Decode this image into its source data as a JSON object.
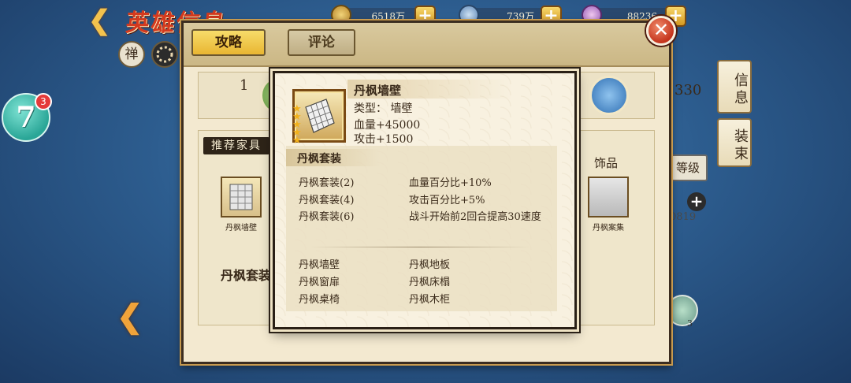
{
  "topbar": {
    "hero_title": "英雄信息",
    "resources": [
      {
        "icon": "coin-icon",
        "value": "6518万"
      },
      {
        "icon": "fish-icon",
        "value": "739万"
      },
      {
        "icon": "gem-icon",
        "value": "88236"
      }
    ]
  },
  "left": {
    "badge_number": "7",
    "badge_count": "3",
    "zen_label": "禅"
  },
  "panel": {
    "tabs": [
      {
        "label": "攻略",
        "active": true
      },
      {
        "label": "评论",
        "active": false
      }
    ],
    "hero_row_number": "1",
    "recommended_label": "推荐家具",
    "furniture_items": [
      "丹枫墙壁",
      ""
    ],
    "suit_name": "丹枫套装",
    "decor_label": "饰品",
    "decor_item_label": "丹枫案集"
  },
  "right": {
    "tab_info": "信息",
    "tab_outfit": "装束",
    "number": "330",
    "level_label": "等级",
    "number2": "0819",
    "shield_count": "3"
  },
  "popup": {
    "item_name": "丹枫墙壁",
    "item_stars": 5,
    "type_line": "类型：  墙壁",
    "hp_line": "血量+45000",
    "atk_line": "攻击+1500",
    "set_title": "丹枫套装",
    "bonuses": [
      {
        "name": "丹枫套装(2)",
        "effect": "血量百分比+10%"
      },
      {
        "name": "丹枫套装(4)",
        "effect": "攻击百分比+5%"
      },
      {
        "name": "丹枫套装(6)",
        "effect": "战斗开始前2回合提高30速度"
      }
    ],
    "set_pieces": [
      "丹枫墙壁",
      "丹枫地板",
      "丹枫窗扉",
      "丹枫床榻",
      "丹枫桌椅",
      "丹枫木柜"
    ]
  },
  "colors": {
    "panel_bg": "#f3e9d0",
    "tab_active": "#e9b632",
    "close_red": "#c4331c",
    "background_blue": "#2d5d8f"
  }
}
